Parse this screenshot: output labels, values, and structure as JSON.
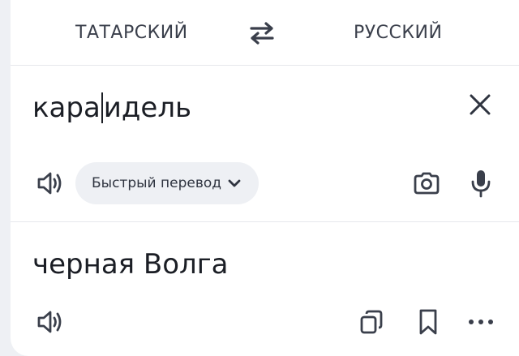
{
  "languages": {
    "source": "ТАТАРСКИЙ",
    "target": "РУССКИЙ"
  },
  "input": {
    "text_before_cursor": "кара",
    "text_after_cursor": "идель"
  },
  "controls": {
    "quick_translate_label": "Быстрый перевод"
  },
  "output": {
    "text": "черная Волга"
  },
  "icons": {
    "swap": "swap-arrows-icon",
    "clear": "close-icon",
    "speak": "speaker-icon",
    "camera": "camera-icon",
    "mic": "microphone-icon",
    "copy": "copy-icon",
    "bookmark": "bookmark-icon",
    "more": "more-dots-icon"
  },
  "colors": {
    "background": "#eef0f4",
    "card": "#ffffff",
    "text": "#1b1e25",
    "icon": "#3a3f4b",
    "chip": "#eef0f4"
  }
}
